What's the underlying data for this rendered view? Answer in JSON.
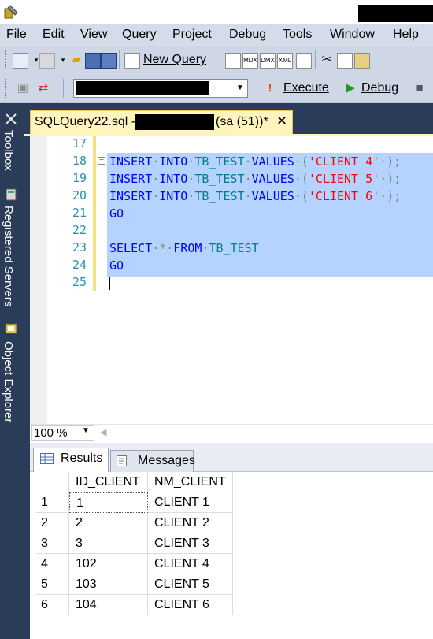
{
  "menu": [
    "File",
    "Edit",
    "View",
    "Query",
    "Project",
    "Debug",
    "Tools",
    "Window",
    "Help"
  ],
  "toolbar": {
    "new_query_label": "New Query",
    "execute_label": "Execute",
    "debug_label": "Debug"
  },
  "side_tabs": [
    "Toolbox",
    "Registered Servers",
    "Object Explorer"
  ],
  "document_tab": {
    "name": "SQLQuery22.sql -",
    "connection": "(sa (51))*",
    "close_glyph": "✕"
  },
  "editor": {
    "line_numbers": [
      "17",
      "18",
      "19",
      "20",
      "21",
      "22",
      "23",
      "24",
      "25"
    ],
    "lines": [
      {
        "kw1": "INSERT",
        "kw2": "INTO",
        "obj": "TB_TEST",
        "kw3": "VALUES",
        "open": "(",
        "str": "'CLIENT 4'",
        "close": ");"
      },
      {
        "kw1": "INSERT",
        "kw2": "INTO",
        "obj": "TB_TEST",
        "kw3": "VALUES",
        "open": "(",
        "str": "'CLIENT 5'",
        "close": ");"
      },
      {
        "kw1": "INSERT",
        "kw2": "INTO",
        "obj": "TB_TEST",
        "kw3": "VALUES",
        "open": "(",
        "str": "'CLIENT 6'",
        "close": ");"
      }
    ],
    "go1": "GO",
    "select_kw": "SELECT",
    "star": "*",
    "from_kw": "FROM",
    "select_obj": "TB_TEST",
    "go2": "GO",
    "outline_glyph": "−"
  },
  "zoom": {
    "value": "100 %"
  },
  "results": {
    "tabs": [
      "Results",
      "Messages"
    ],
    "columns": [
      "ID_CLIENT",
      "NM_CLIENT"
    ],
    "rows": [
      {
        "n": "1",
        "id": "1",
        "name": "CLIENT 1"
      },
      {
        "n": "2",
        "id": "2",
        "name": "CLIENT 2"
      },
      {
        "n": "3",
        "id": "3",
        "name": "CLIENT 3"
      },
      {
        "n": "4",
        "id": "102",
        "name": "CLIENT 4"
      },
      {
        "n": "5",
        "id": "103",
        "name": "CLIENT 5"
      },
      {
        "n": "6",
        "id": "104",
        "name": "CLIENT 6"
      }
    ]
  },
  "colors": {
    "keyword": "#0000ff",
    "string": "#ff0000",
    "selection": "#b4d4ff",
    "tab_active": "#fff4bc",
    "frame": "#2b3c59"
  }
}
